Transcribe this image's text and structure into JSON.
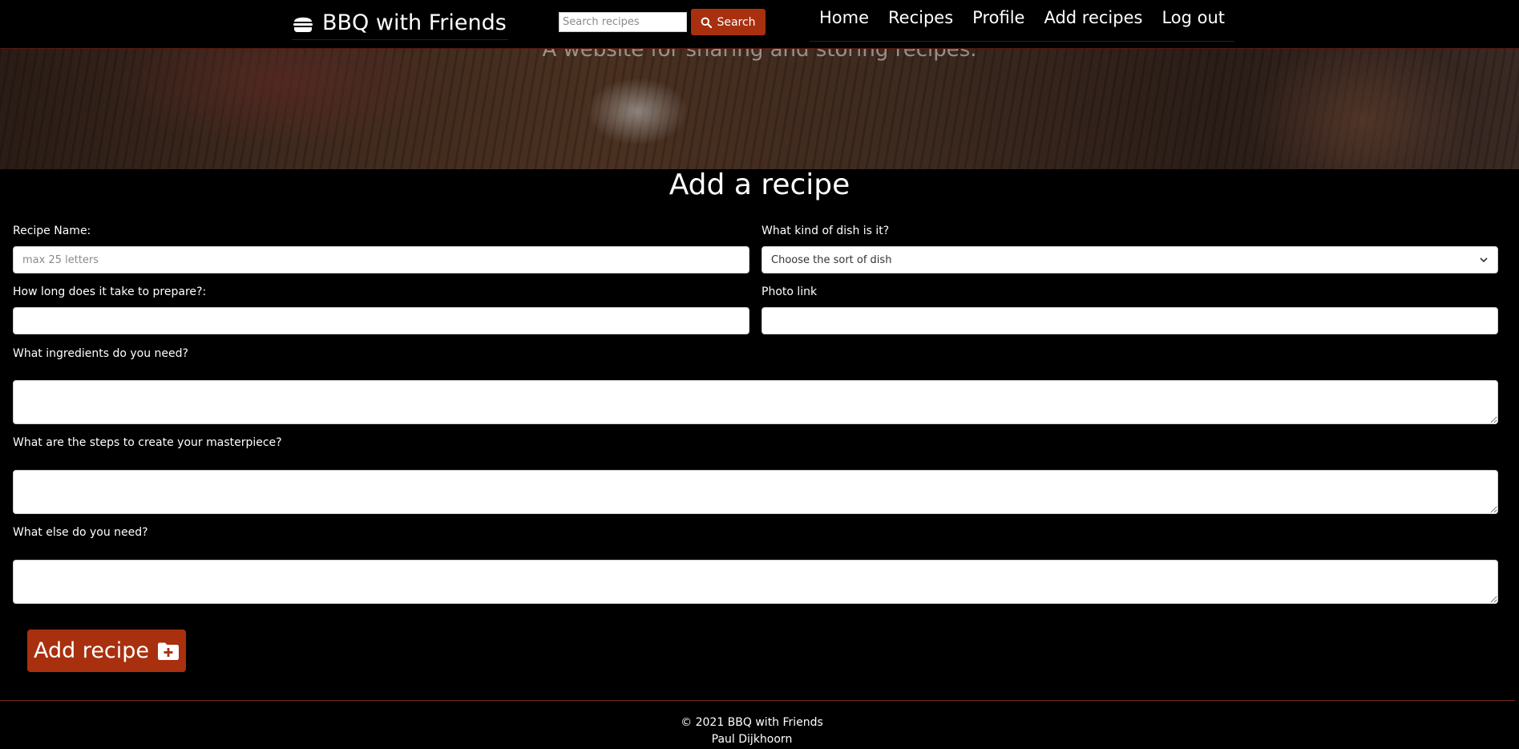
{
  "navbar": {
    "brand": "BBQ with Friends",
    "brand_icon": "burger-icon",
    "search_placeholder": "Search recipes",
    "search_value": "",
    "search_button_label": "Search",
    "search_icon": "search-icon",
    "links": [
      "Home",
      "Recipes",
      "Profile",
      "Add recipes",
      "Log out"
    ]
  },
  "hero": {
    "tagline": "A website for sharing and storing recipes."
  },
  "form": {
    "title": "Add a recipe",
    "recipe_name_label": "Recipe Name:",
    "recipe_name_placeholder": "max 25 letters",
    "recipe_name_value": "",
    "dish_kind_label": "What kind of dish is it?",
    "dish_kind_selected": "Choose the sort of dish",
    "prep_time_label": "How long does it take to prepare?:",
    "prep_time_value": "",
    "photo_link_label": "Photo link",
    "photo_link_value": "",
    "ingredients_label": "What ingredients do you need?",
    "ingredients_value": "",
    "steps_label": "What are the steps to create your masterpiece?",
    "steps_value": "",
    "extras_label": "What else do you need?",
    "extras_value": "",
    "submit_label": "Add recipe",
    "submit_icon": "folder-plus-icon"
  },
  "footer": {
    "copyright": "© 2021 BBQ with Friends",
    "author": "Paul Dijkhoorn"
  },
  "colors": {
    "accent": "#a8300f",
    "background": "#000000",
    "text": "#ffffff"
  }
}
